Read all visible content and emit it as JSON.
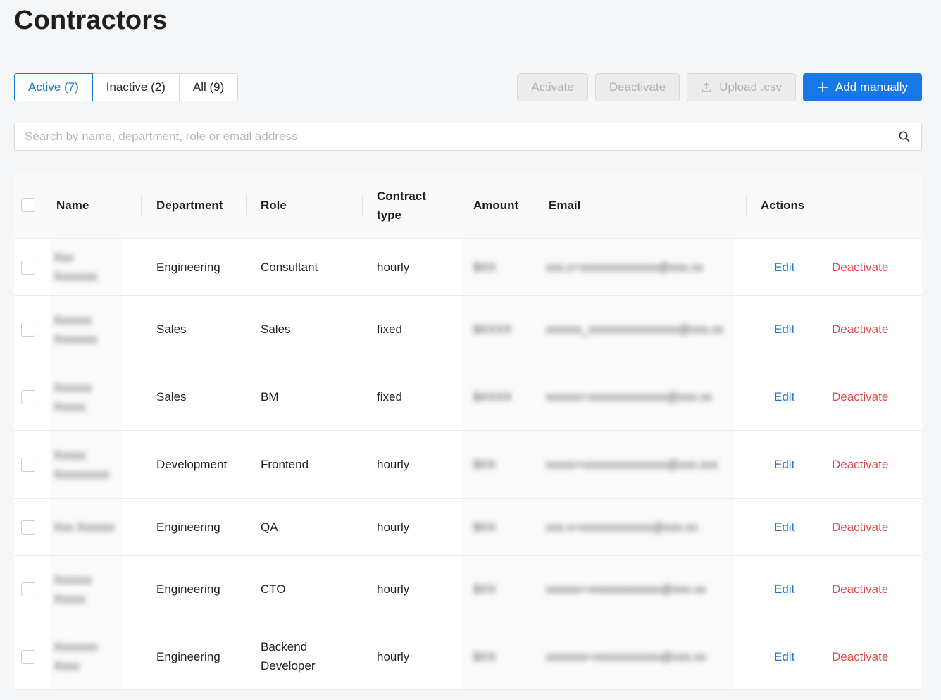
{
  "page": {
    "title": "Contractors"
  },
  "tabs": [
    {
      "label": "Active (7)",
      "active": true
    },
    {
      "label": "Inactive (2)",
      "active": false
    },
    {
      "label": "All (9)",
      "active": false
    }
  ],
  "toolbar": {
    "activate_label": "Activate",
    "deactivate_label": "Deactivate",
    "upload_label": "Upload .csv",
    "add_label": "Add manually"
  },
  "search": {
    "placeholder": "Search by name, department, role or email address"
  },
  "table": {
    "headers": {
      "name": "Name",
      "department": "Department",
      "role": "Role",
      "contract_type": "Contract type",
      "amount": "Amount",
      "email": "Email",
      "actions": "Actions"
    },
    "edit_label": "Edit",
    "deactivate_label": "Deactivate",
    "rows": [
      {
        "name": "Xxx Xxxxxxx",
        "department": "Engineering",
        "role": "Consultant",
        "contract_type": "hourly",
        "amount": "$XX",
        "email": "xxx.x+xxxxxxxxxxxxx@xxx.xx"
      },
      {
        "name": "Xxxxxx Xxxxxxx",
        "department": "Sales",
        "role": "Sales",
        "contract_type": "fixed",
        "amount": "$XXXX",
        "email": "xxxxxx_xxxxxxxxxxxxxxx@xxx.xx"
      },
      {
        "name": "Xxxxxx Xxxxx",
        "department": "Sales",
        "role": "BM",
        "contract_type": "fixed",
        "amount": "$XXXX",
        "email": "xxxxxx+xxxxxxxxxxxxx@xxx.xx"
      },
      {
        "name": "Xxxxx Xxxxxxxxx",
        "department": "Development",
        "role": "Frontend",
        "contract_type": "hourly",
        "amount": "$XX",
        "email": "xxxxx+xxxxxxxxxxxxxx@xxx.xxx"
      },
      {
        "name": "Xxx Xxxxxx",
        "department": "Engineering",
        "role": "QA",
        "contract_type": "hourly",
        "amount": "$XX",
        "email": "xxx.x+xxxxxxxxxxxx@xxx.xx"
      },
      {
        "name": "Xxxxxx Xxxxx",
        "department": "Engineering",
        "role": "CTO",
        "contract_type": "hourly",
        "amount": "$XX",
        "email": "xxxxxx+xxxxxxxxxxxx@xxx.xx"
      },
      {
        "name": "Xxxxxxx Xxxx",
        "department": "Engineering",
        "role": "Backend Developer",
        "contract_type": "hourly",
        "amount": "$XX",
        "email": "xxxxxxx+xxxxxxxxxxx@xxx.xx"
      }
    ]
  }
}
